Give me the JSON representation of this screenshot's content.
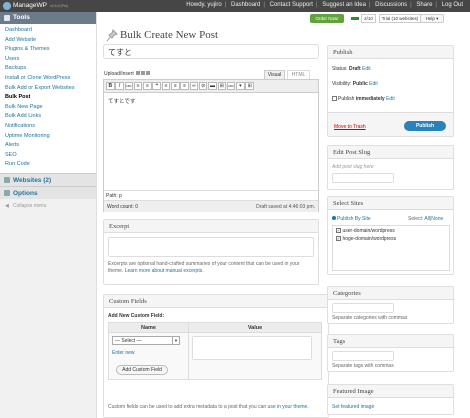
{
  "topbar": {
    "brand": "ManageWP",
    "version": "v2.6.6 (Pro)",
    "links": [
      "Howdy, yujiro",
      "Dashboard",
      "Contact Support",
      "Suggest an Idea",
      "Discussions",
      "Share",
      "Log Out"
    ]
  },
  "header": {
    "order_now": "Order Now!",
    "count": "2/10",
    "trial": "Trial (10 websites)",
    "help": "Help ▾"
  },
  "sidebar": {
    "tools": "Tools",
    "items": [
      "Dashboard",
      "Add Website",
      "Plugins & Themes",
      "Users",
      "Backups",
      "Install or Clone WordPress",
      "Bulk Add or Export Websites",
      "Bulk Post",
      "Bulk New Page",
      "Bulk Add Links",
      "Notifications",
      "Uptime Monitoring",
      "Alerts",
      "SEO",
      "Run Code"
    ],
    "websites": "Websites (2)",
    "options": "Options",
    "collapse": "Collapse menu"
  },
  "page": {
    "title": "Bulk Create New Post",
    "post_title": "てすと"
  },
  "editor": {
    "upload_insert": "Upload/Insert",
    "tab_visual": "Visual",
    "tab_html": "HTML",
    "toolbar": [
      "B",
      "I",
      "ABC",
      "≡",
      "≡",
      "❝",
      "≡",
      "≡",
      "≡",
      "∞",
      "⊘",
      "▬",
      "⊞",
      "ABC",
      "▾",
      "⊞"
    ],
    "content": "てすとです",
    "path": "Path: p",
    "word_count": "Word count: 0",
    "draft_saved": "Draft saved at 4:46:03 pm."
  },
  "excerpt": {
    "title": "Excerpt",
    "help_text": "Excerpts are optional hand-crafted summaries of your content that can be used in your theme.",
    "help_link": "Learn more about manual excerpts."
  },
  "custom_fields": {
    "title": "Custom Fields",
    "add_new": "Add New Custom Field:",
    "col_name": "Name",
    "col_value": "Value",
    "select_value": "— Select —",
    "enter_new": "Enter new",
    "add_button": "Add Custom Field",
    "help_text": "Custom fields can be used to add extra metadata to a post that you can",
    "help_link": "use in your theme."
  },
  "publish": {
    "title": "Publish",
    "status_label": "Status:",
    "status_value": "Draft",
    "visibility_label": "Visibility:",
    "visibility_value": "Public",
    "publish_label": "Publish",
    "publish_value": "immediately",
    "edit": "Edit",
    "trash": "Move to Trash",
    "button": "Publish"
  },
  "slug": {
    "title": "Edit Post Slug",
    "placeholder": "Add post slug here"
  },
  "sites": {
    "title": "Select Sites",
    "publish_by": "Publish By Site",
    "select": "Select:",
    "all": "All",
    "none": "None",
    "items": [
      "user-domain/wordpress",
      "hoge-domain/wordpress"
    ]
  },
  "categories": {
    "title": "Categories",
    "help": "Separate categories with commas"
  },
  "tags": {
    "title": "Tags",
    "help": "Separate tags with commas"
  },
  "featured": {
    "title": "Featured Image",
    "link": "Set featured image"
  }
}
